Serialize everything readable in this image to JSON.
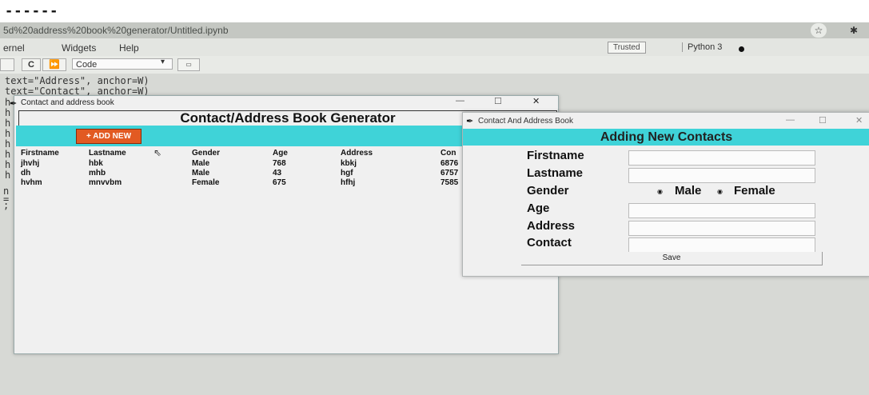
{
  "top_marker": "------",
  "browser": {
    "url": "5d%20address%20book%20generator/Untitled.ipynb",
    "menu": [
      "ernel",
      "Widgets",
      "Help"
    ],
    "trusted": "Trusted",
    "kernel": "Python 3",
    "cell_type": "Code"
  },
  "code_lines": [
    "text=\"Address\", anchor=W)",
    "text=\"Contact\", anchor=W)"
  ],
  "gutter": [
    "h",
    "h",
    "h",
    "h",
    "h",
    "h",
    "h",
    "h",
    "n",
    "=",
    ";"
  ],
  "main_window": {
    "title": "Contact and address book",
    "heading": "Contact/Address Book Generator",
    "add_new": "+ ADD NEW",
    "columns": [
      "Firstname",
      "Lastname",
      "Gender",
      "Age",
      "Address",
      "Con"
    ],
    "rows": [
      [
        "jhvhj",
        "hbk",
        "Male",
        "768",
        "kbkj",
        "6876"
      ],
      [
        "dh",
        "mhb",
        "Male",
        "43",
        "hgf",
        "6757"
      ],
      [
        "hvhm",
        "mnvvbm",
        "Female",
        "675",
        "hfhj",
        "7585"
      ]
    ]
  },
  "dialog": {
    "title": "Contact And Address Book",
    "heading": "Adding New Contacts",
    "labels": {
      "firstname": "Firstname",
      "lastname": "Lastname",
      "gender": "Gender",
      "age": "Age",
      "address": "Address",
      "contact": "Contact"
    },
    "gender_options": [
      "Male",
      "Female"
    ],
    "save": "Save"
  },
  "colors": {
    "cyan": "#3fd3d8",
    "orange": "#e25a22"
  }
}
